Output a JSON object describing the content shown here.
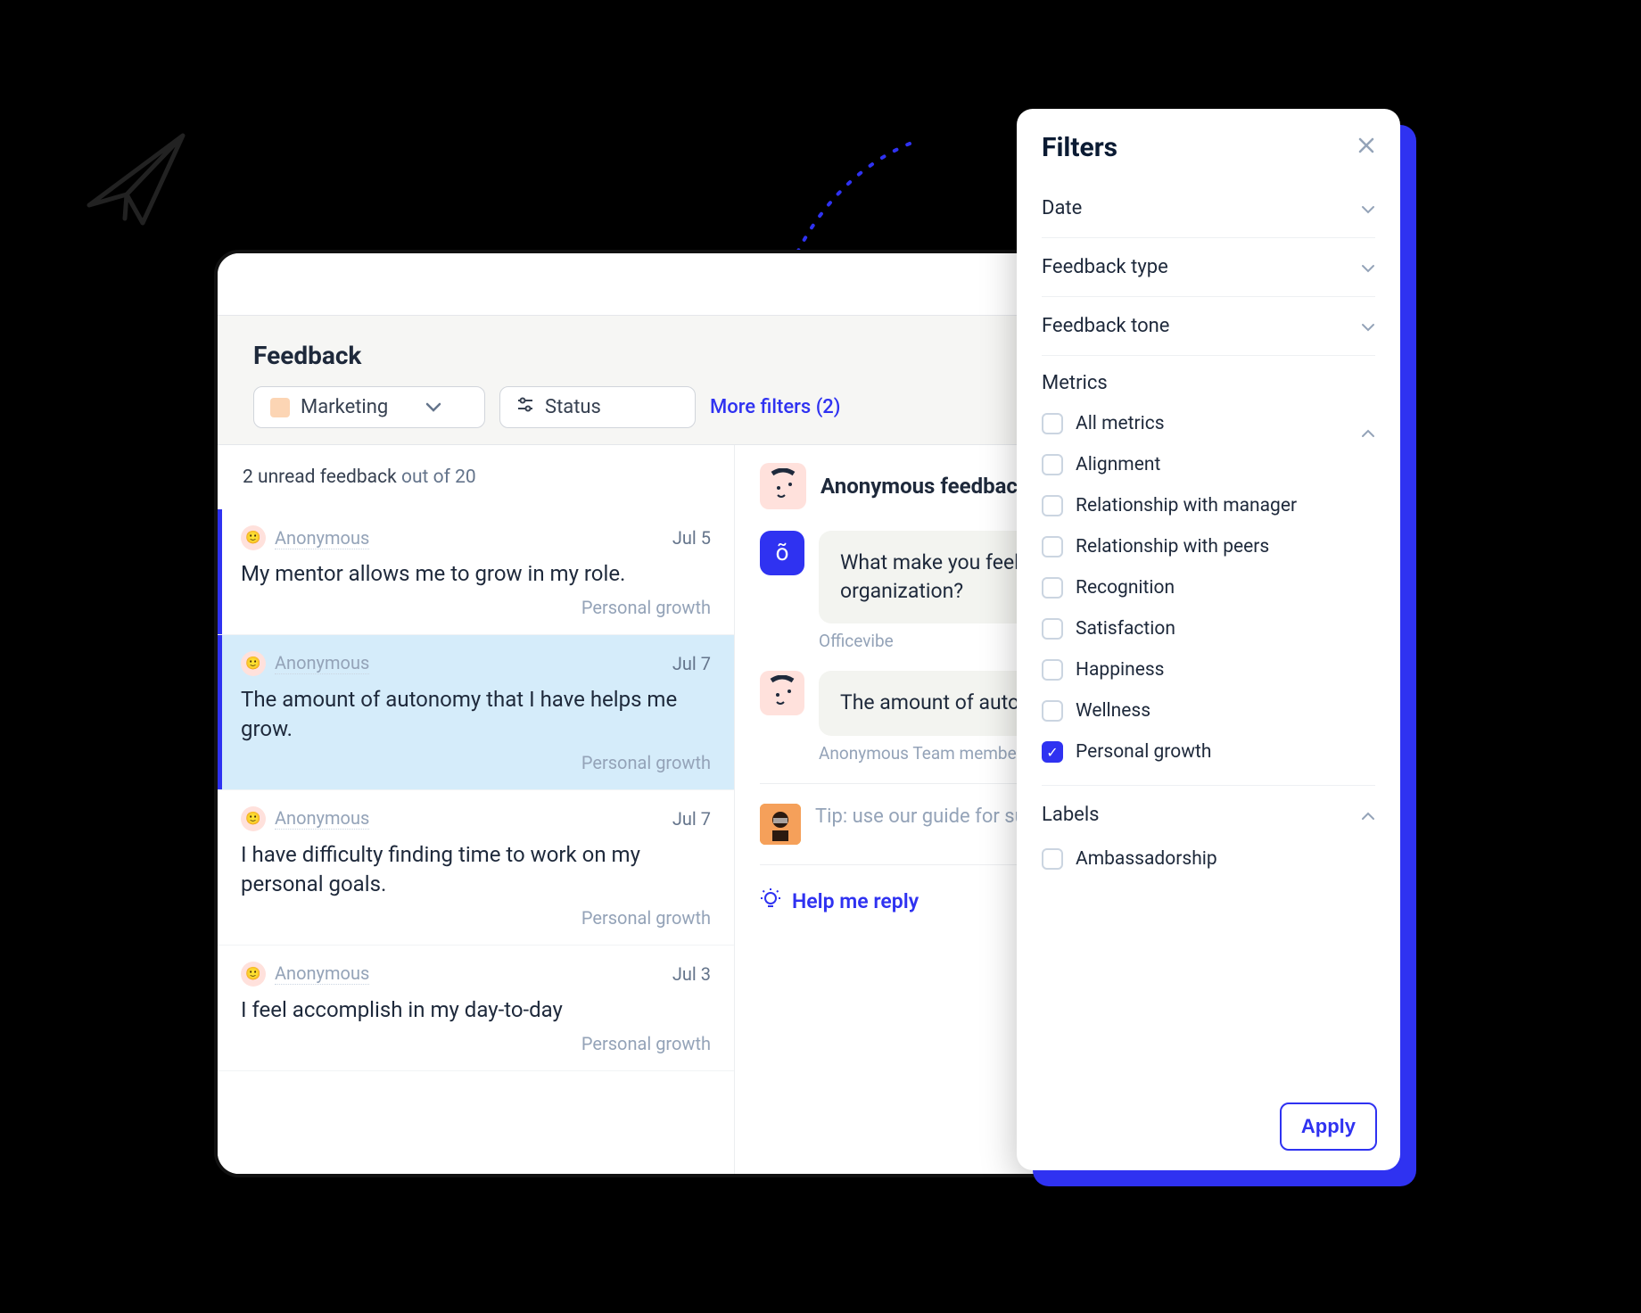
{
  "page": {
    "title": "Feedback"
  },
  "toolbar": {
    "category": "Marketing",
    "status_label": "Status",
    "more_filters": "More filters (2)"
  },
  "unread": {
    "count_text": "2 unread feedback",
    "total_text": "out of 20"
  },
  "feedback_items": [
    {
      "author": "Anonymous",
      "date": "Jul 5",
      "text": "My mentor allows me to grow in my role.",
      "tag": "Personal growth"
    },
    {
      "author": "Anonymous",
      "date": "Jul 7",
      "text": "The amount of autonomy that I have helps me grow.",
      "tag": "Personal growth"
    },
    {
      "author": "Anonymous",
      "date": "Jul 7",
      "text": "I have difficulty finding time to work on my personal goals.",
      "tag": "Personal growth"
    },
    {
      "author": "Anonymous",
      "date": "Jul 3",
      "text": "I feel accomplish in my day-to-day",
      "tag": "Personal growth"
    }
  ],
  "detail": {
    "title": "Anonymous feedback",
    "question": "What make you feel autonomous within your organization?",
    "question_caption": "Officevibe",
    "answer": "The amount of autonomy I have helps me grow.",
    "answer_caption": "Anonymous Team member",
    "tip": "Tip: use our guide for suggestions on how to reply.",
    "help_reply": "Help me reply"
  },
  "filters": {
    "title": "Filters",
    "sections": {
      "date": "Date",
      "type": "Feedback type",
      "tone": "Feedback tone"
    },
    "metrics_title": "Metrics",
    "metrics": [
      {
        "label": "All metrics",
        "checked": false
      },
      {
        "label": "Alignment",
        "checked": false
      },
      {
        "label": "Relationship with manager",
        "checked": false
      },
      {
        "label": "Relationship with peers",
        "checked": false
      },
      {
        "label": "Recognition",
        "checked": false
      },
      {
        "label": "Satisfaction",
        "checked": false
      },
      {
        "label": "Happiness",
        "checked": false
      },
      {
        "label": "Wellness",
        "checked": false
      },
      {
        "label": "Personal growth",
        "checked": true
      }
    ],
    "labels_title": "Labels",
    "labels": [
      {
        "label": "Ambassadorship",
        "checked": false
      }
    ],
    "apply": "Apply"
  }
}
